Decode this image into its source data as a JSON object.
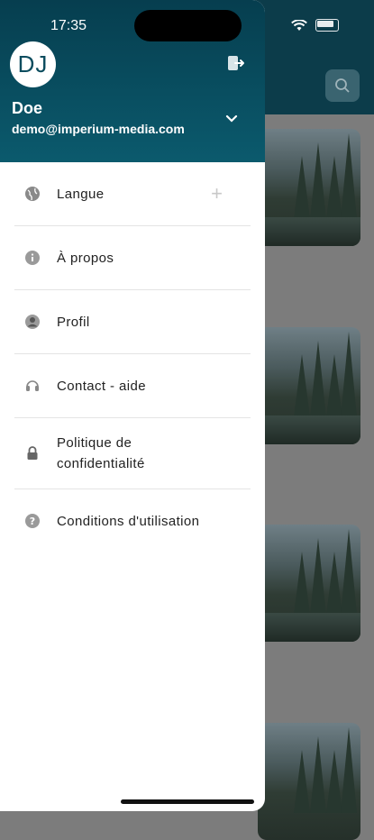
{
  "status_bar": {
    "time": "17:35"
  },
  "user": {
    "initials": "DJ",
    "name": "Doe",
    "email": "demo@imperium-media.com"
  },
  "menu": [
    {
      "label": "Langue",
      "icon": "globe-icon"
    },
    {
      "label": "À propos",
      "icon": "info-icon"
    },
    {
      "label": "Profil",
      "icon": "user-icon"
    },
    {
      "label": "Contact - aide",
      "icon": "headset-icon"
    },
    {
      "label": "Politique de confidentialité",
      "icon": "lock-icon"
    },
    {
      "label": "Conditions d'utilisation",
      "icon": "question-icon"
    }
  ],
  "colors": {
    "header": "#0b5a6d",
    "background_header": "#0c3c4a"
  }
}
